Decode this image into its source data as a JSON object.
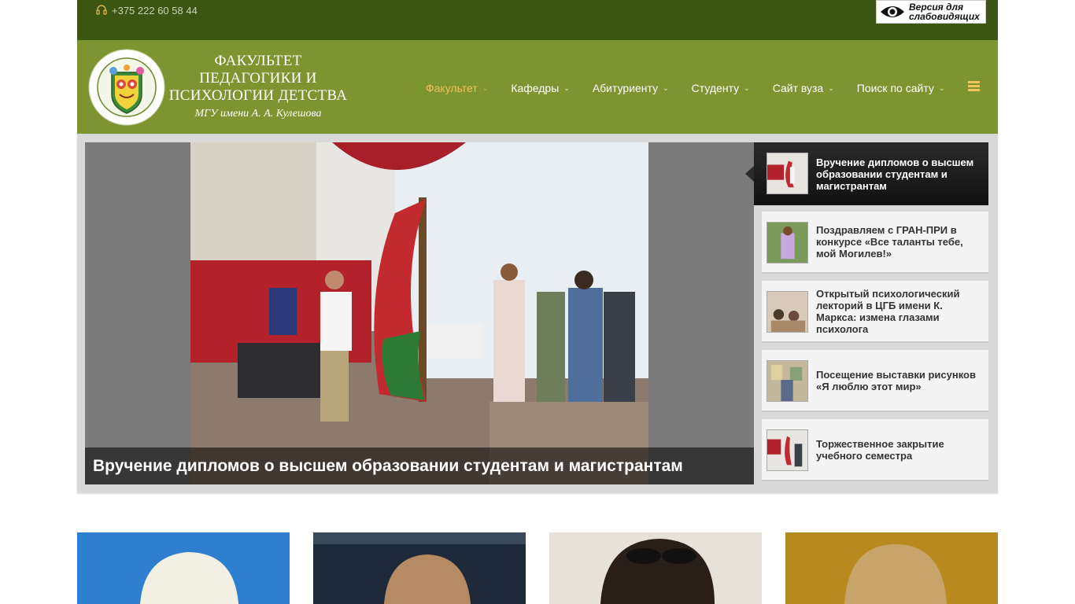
{
  "topbar": {
    "phone": "+375 222 60 58 44",
    "vision_label_line1": "Версия для",
    "vision_label_line2": "слабовидящих"
  },
  "header": {
    "logo_line1": "ФАКУЛЬТЕТ",
    "logo_line2": "ПЕДАГОГИКИ И",
    "logo_line3": "ПСИХОЛОГИИ ДЕТСТВА",
    "logo_line4": "МГУ имени А. А. Кулешова",
    "logo_ring_text": "факультет педагогики и психологии детства"
  },
  "nav": {
    "items": [
      {
        "label": "Факультет",
        "active": true
      },
      {
        "label": "Кафедры"
      },
      {
        "label": "Абитуриенту"
      },
      {
        "label": "Студенту"
      },
      {
        "label": "Сайт вуза"
      },
      {
        "label": "Поиск по сайту"
      }
    ],
    "chevron": "⌄"
  },
  "slider": {
    "caption": "Вручение дипломов о высшем образовании студентам и магистрантам",
    "news": [
      {
        "title": "Вручение дипломов о высшем образовании студентам и магистрантам"
      },
      {
        "title": "Поздравляем с ГРАН-ПРИ в конкурсе «Все таланты тебе, мой Могилев!»"
      },
      {
        "title": "Открытый психологический лекторий в ЦГБ имени К. Маркса: измена глазами психолога"
      },
      {
        "title": "Посещение выставки рисунков «Я люблю этот мир»"
      },
      {
        "title": "Торжественное закрытие учебного семестра"
      }
    ]
  },
  "colors": {
    "topbar": "#3d5513",
    "header": "#7c9530",
    "accent": "#f2c25b"
  }
}
